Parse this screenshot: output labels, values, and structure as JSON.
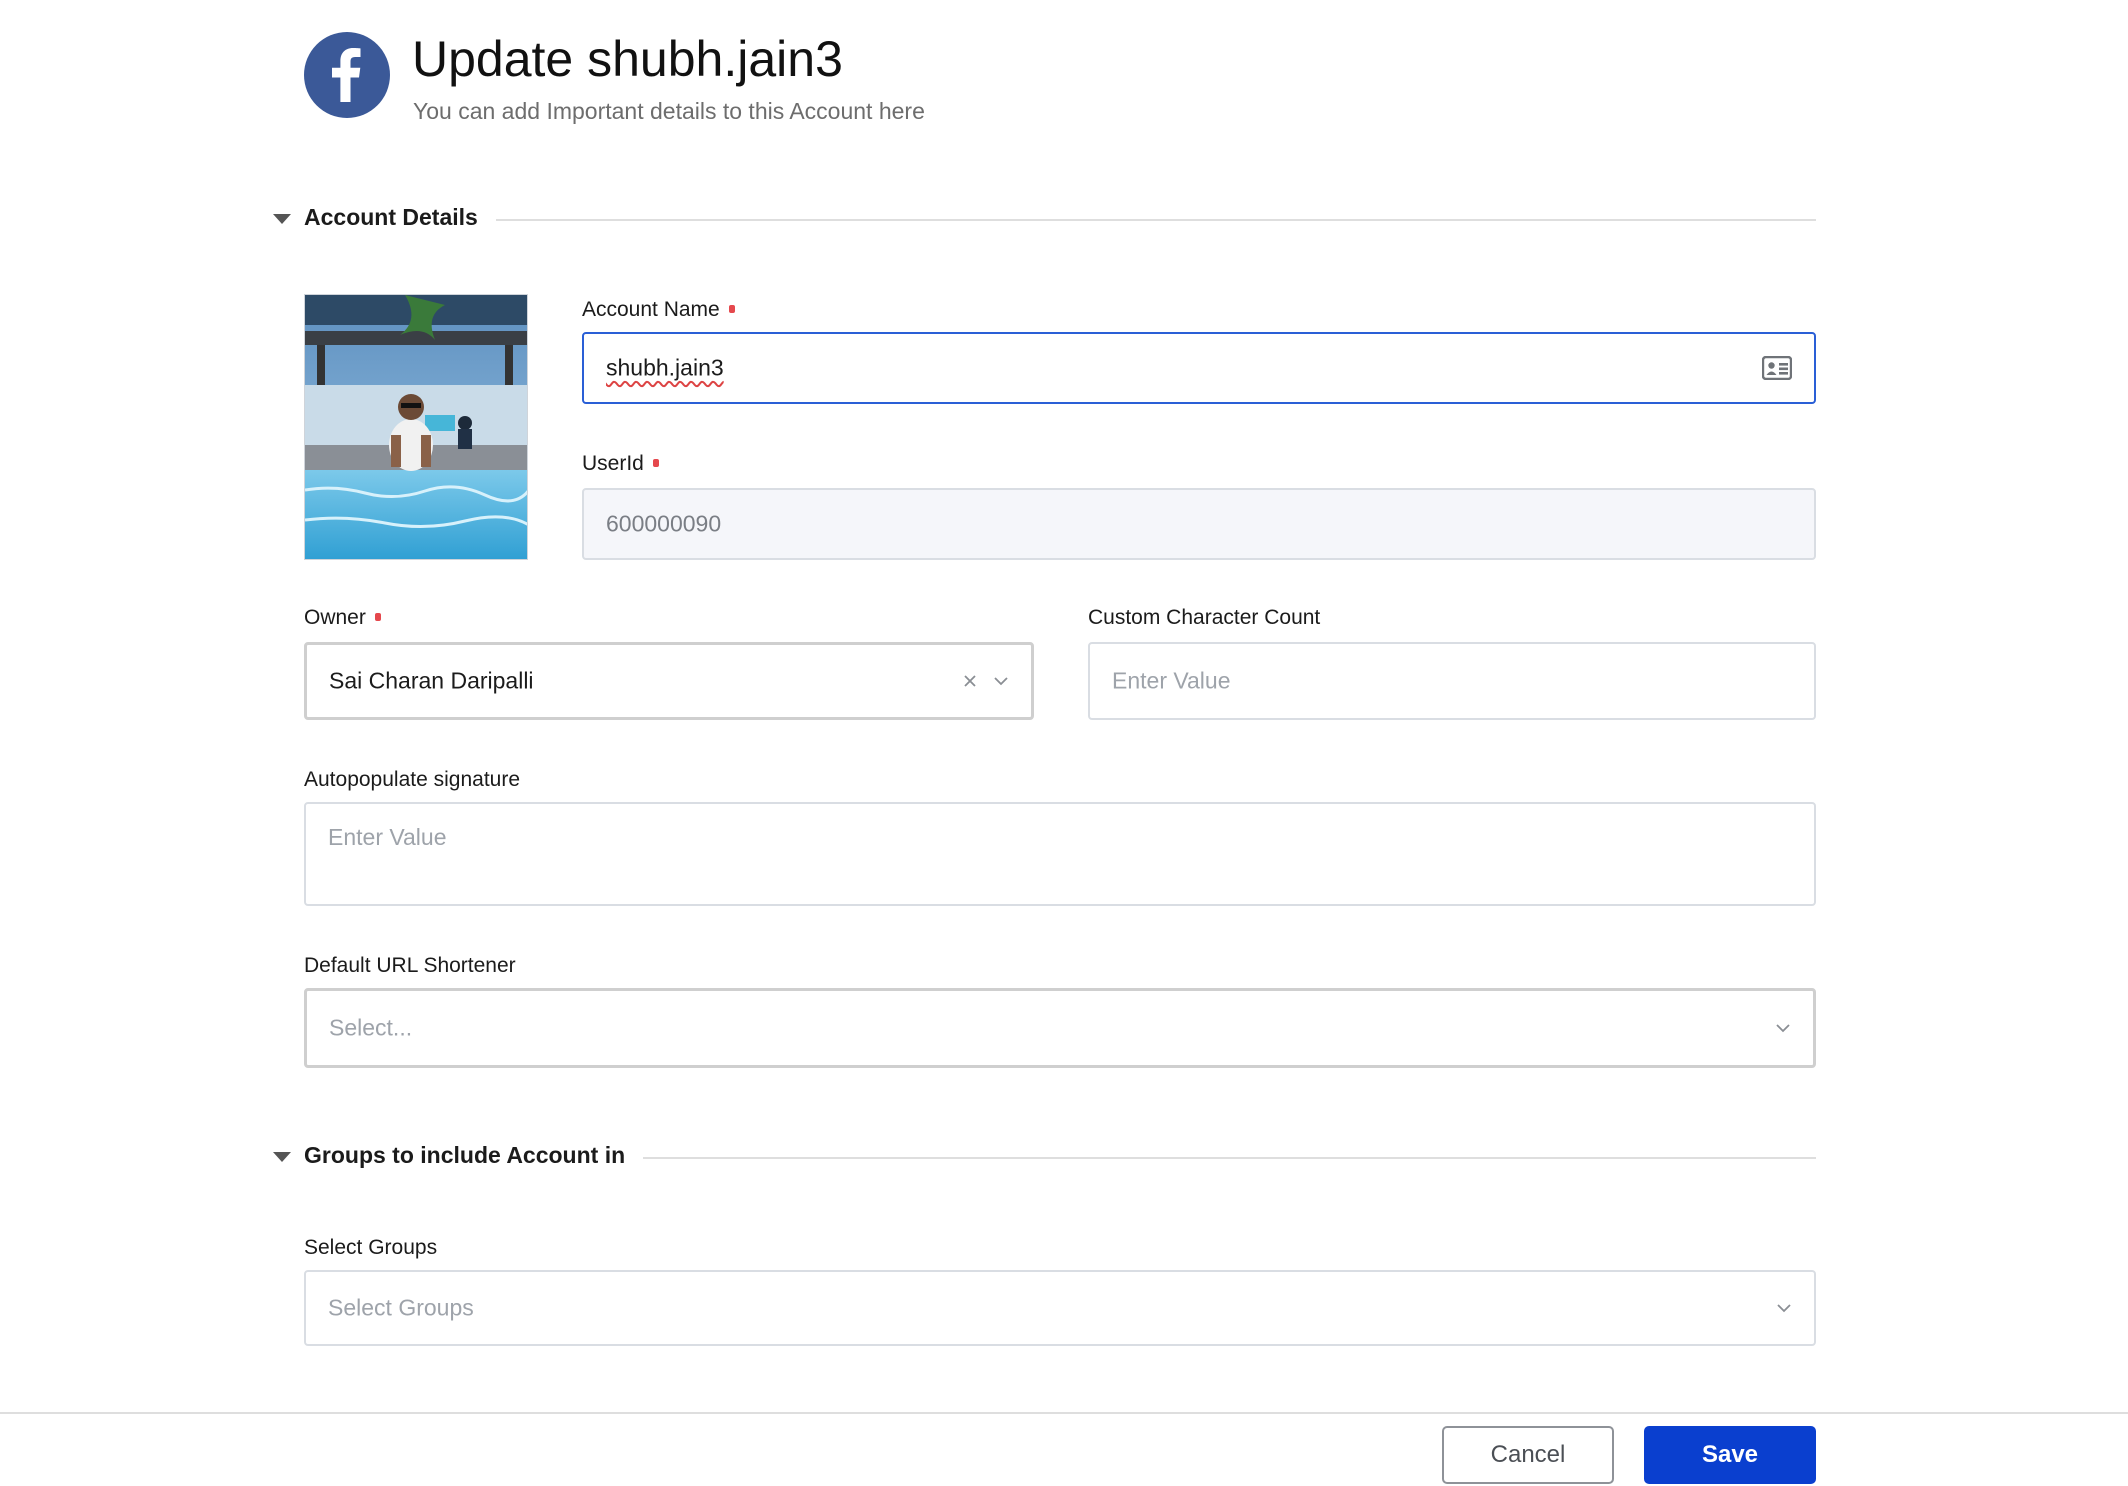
{
  "header": {
    "icon": "facebook-icon",
    "title": "Update shubh.jain3",
    "subtitle": "You can add Important details to this Account here"
  },
  "sections": {
    "account_details": {
      "title": "Account Details",
      "expanded": true
    },
    "groups": {
      "title": "Groups to include Account in",
      "expanded": true
    }
  },
  "fields": {
    "account_name": {
      "label": "Account Name",
      "required": true,
      "value": "shubh.jain3",
      "icon": "contact-card-icon"
    },
    "user_id": {
      "label": "UserId",
      "required": true,
      "value": "600000090"
    },
    "owner": {
      "label": "Owner",
      "required": true,
      "value": "Sai Charan Daripalli"
    },
    "custom_character_count": {
      "label": "Custom Character Count",
      "placeholder": "Enter Value"
    },
    "autopopulate_signature": {
      "label": "Autopopulate signature",
      "placeholder": "Enter Value"
    },
    "default_url_shortener": {
      "label": "Default URL Shortener",
      "placeholder": "Select..."
    },
    "select_groups": {
      "label": "Select Groups",
      "placeholder": "Select Groups"
    }
  },
  "footer": {
    "cancel_label": "Cancel",
    "save_label": "Save"
  },
  "colors": {
    "facebook_blue": "#3b5998",
    "primary": "#0a3fcf",
    "focus_border": "#2a5fd6",
    "required_marker": "#e5484d"
  }
}
